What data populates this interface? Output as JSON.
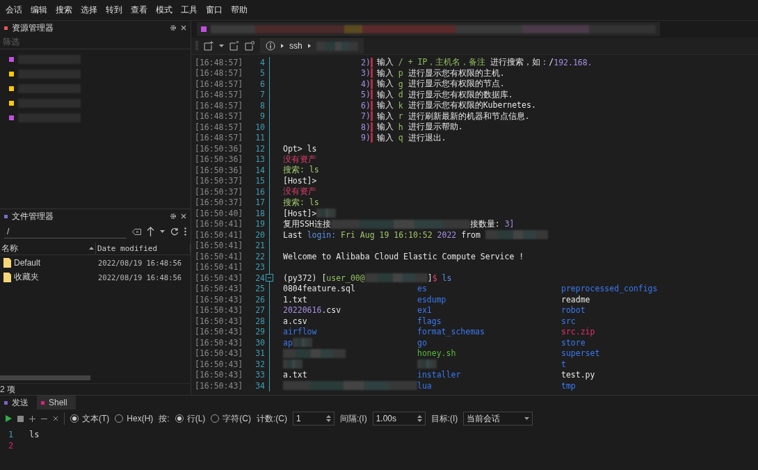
{
  "menu": [
    "会话",
    "编辑",
    "搜索",
    "选择",
    "转到",
    "查看",
    "模式",
    "工具",
    "窗口",
    "帮助"
  ],
  "resource_manager": {
    "title": "资源管理器",
    "filter": {
      "placeholder": "筛选"
    },
    "items": [
      {
        "color": "#c050e0"
      },
      {
        "color": "#ffcc00"
      },
      {
        "color": "#ffcc00"
      },
      {
        "color": "#ffcc00"
      },
      {
        "color": "#c050e0"
      }
    ]
  },
  "file_manager": {
    "title": "文件管理器",
    "path": "/",
    "columns": [
      "名称",
      "Date modified"
    ],
    "rows": [
      {
        "name": "Default",
        "date": "2022/08/19 16:48:56"
      },
      {
        "name": "收藏夹",
        "date": "2022/08/19 16:48:56"
      }
    ],
    "status": "2 项"
  },
  "toolbar": {
    "breadcrumb": [
      "ssh"
    ]
  },
  "terminal": {
    "lines": [
      {
        "time": "[16:48:57]",
        "num": "4",
        "segs": [
          {
            "kind": "marker",
            "text": "2)"
          },
          {
            "kind": "plain",
            "text": "输入 "
          },
          {
            "kind": "arg",
            "text": "/ + IP，主机名，备注"
          },
          {
            "kind": "plain",
            "text": " 进行搜索，如：/"
          },
          {
            "kind": "num",
            "text": "192.168."
          }
        ]
      },
      {
        "time": "[16:48:57]",
        "num": "5",
        "segs": [
          {
            "kind": "marker",
            "text": "3)"
          },
          {
            "kind": "plain",
            "text": "输入 "
          },
          {
            "kind": "arg",
            "text": "p"
          },
          {
            "kind": "plain",
            "text": " 进行显示您有权限的主机."
          }
        ]
      },
      {
        "time": "[16:48:57]",
        "num": "6",
        "segs": [
          {
            "kind": "marker",
            "text": "4)"
          },
          {
            "kind": "plain",
            "text": "输入 "
          },
          {
            "kind": "arg",
            "text": "g"
          },
          {
            "kind": "plain",
            "text": " 进行显示您有权限的节点."
          }
        ]
      },
      {
        "time": "[16:48:57]",
        "num": "7",
        "segs": [
          {
            "kind": "marker",
            "text": "5)"
          },
          {
            "kind": "plain",
            "text": "输入 "
          },
          {
            "kind": "arg",
            "text": "d"
          },
          {
            "kind": "plain",
            "text": " 进行显示您有权限的数据库."
          }
        ]
      },
      {
        "time": "[16:48:57]",
        "num": "8",
        "segs": [
          {
            "kind": "marker",
            "text": "6)"
          },
          {
            "kind": "plain",
            "text": "输入 "
          },
          {
            "kind": "arg",
            "text": "k"
          },
          {
            "kind": "plain",
            "text": " 进行显示您有权限的Kubernetes."
          }
        ]
      },
      {
        "time": "[16:48:57]",
        "num": "9",
        "segs": [
          {
            "kind": "marker",
            "text": "7)"
          },
          {
            "kind": "plain",
            "text": "输入 "
          },
          {
            "kind": "arg",
            "text": "r"
          },
          {
            "kind": "plain",
            "text": " 进行刷新最新的机器和节点信息."
          }
        ]
      },
      {
        "time": "[16:48:57]",
        "num": "10",
        "segs": [
          {
            "kind": "marker",
            "text": "8)"
          },
          {
            "kind": "plain",
            "text": "输入 "
          },
          {
            "kind": "arg",
            "text": "h"
          },
          {
            "kind": "plain",
            "text": " 进行显示帮助."
          }
        ]
      },
      {
        "time": "[16:48:57]",
        "num": "11",
        "segs": [
          {
            "kind": "marker",
            "text": "9)"
          },
          {
            "kind": "plain",
            "text": "输入 "
          },
          {
            "kind": "arg",
            "text": "q"
          },
          {
            "kind": "plain",
            "text": " 进行退出."
          }
        ]
      },
      {
        "time": "[16:50:36]",
        "num": "12",
        "segs": [
          {
            "kind": "plain",
            "text": "Opt> ls"
          }
        ]
      },
      {
        "time": "[16:50:36]",
        "num": "13",
        "segs": [
          {
            "kind": "error",
            "text": "没有资产"
          }
        ]
      },
      {
        "time": "[16:50:36]",
        "num": "14",
        "segs": [
          {
            "kind": "ok",
            "text": "搜索: ls"
          }
        ]
      },
      {
        "time": "[16:50:37]",
        "num": "15",
        "segs": [
          {
            "kind": "plain",
            "text": "[Host]>"
          }
        ]
      },
      {
        "time": "[16:50:37]",
        "num": "16",
        "segs": [
          {
            "kind": "error",
            "text": "没有资产"
          }
        ]
      },
      {
        "time": "[16:50:37]",
        "num": "17",
        "segs": [
          {
            "kind": "ok",
            "text": "搜索: ls"
          }
        ]
      },
      {
        "time": "[16:50:40]",
        "num": "18",
        "segs": [
          {
            "kind": "plain",
            "text": "[Host]>"
          },
          {
            "kind": "redact-s"
          }
        ]
      },
      {
        "time": "[16:50:41]",
        "num": "19",
        "segs": [
          {
            "kind": "plain",
            "text": "复用SSH连接"
          },
          {
            "kind": "redact-l"
          },
          {
            "kind": "plain",
            "text": "接数量: "
          },
          {
            "kind": "num",
            "text": "3]"
          }
        ]
      },
      {
        "time": "[16:50:41]",
        "num": "20",
        "segs": [
          {
            "kind": "plain",
            "text": "Last "
          },
          {
            "kind": "key",
            "text": "login:"
          },
          {
            "kind": "ok",
            "text": " Fri Aug 19 16:10:52 "
          },
          {
            "kind": "num",
            "text": "2022"
          },
          {
            "kind": "plain",
            "text": " from "
          },
          {
            "kind": "redact-m"
          }
        ]
      },
      {
        "time": "[16:50:41]",
        "num": "21"
      },
      {
        "time": "[16:50:41]",
        "num": "22",
        "segs": [
          {
            "kind": "plain",
            "text": "Welcome to Alibaba Cloud Elastic Compute Service !"
          }
        ]
      },
      {
        "time": "[16:50:41]",
        "num": "23"
      },
      {
        "time": "[16:50:43]",
        "num": "24",
        "fold": true,
        "segs": [
          {
            "kind": "plain",
            "text": "(py372) ["
          },
          {
            "kind": "arg",
            "text": "user_00@"
          },
          {
            "kind": "redact-m"
          },
          {
            "kind": "plain",
            "text": "]"
          },
          {
            "kind": "error",
            "text": "$"
          },
          {
            "kind": "key",
            "text": " ls"
          }
        ]
      },
      {
        "time": "[16:50:43]",
        "num": "25",
        "cols": [
          [
            {
              "kind": "plain",
              "text": "0804feature.sql"
            }
          ],
          [
            {
              "kind": "dir",
              "text": "es"
            }
          ],
          [
            {
              "kind": "dir",
              "text": "preprocessed_configs"
            }
          ]
        ]
      },
      {
        "time": "[16:50:43]",
        "num": "26",
        "cols": [
          [
            {
              "kind": "plain",
              "text": "1.txt"
            }
          ],
          [
            {
              "kind": "dir",
              "text": "esdump"
            }
          ],
          [
            {
              "kind": "plain",
              "text": "readme"
            }
          ]
        ]
      },
      {
        "time": "[16:50:43]",
        "num": "27",
        "cols": [
          [
            {
              "kind": "num",
              "text": "20220616"
            },
            {
              "kind": "plain",
              "text": ".csv"
            }
          ],
          [
            {
              "kind": "dir",
              "text": "ex1"
            }
          ],
          [
            {
              "kind": "dir",
              "text": "robot"
            }
          ]
        ]
      },
      {
        "time": "[16:50:43]",
        "num": "28",
        "cols": [
          [
            {
              "kind": "plain",
              "text": "a.csv"
            }
          ],
          [
            {
              "kind": "dir",
              "text": "flags"
            }
          ],
          [
            {
              "kind": "dir",
              "text": "src"
            }
          ]
        ]
      },
      {
        "time": "[16:50:43]",
        "num": "29",
        "cols": [
          [
            {
              "kind": "dir",
              "text": "airflow"
            }
          ],
          [
            {
              "kind": "dir",
              "text": "format_schemas"
            }
          ],
          [
            {
              "kind": "archive",
              "text": "src.zip"
            }
          ]
        ]
      },
      {
        "time": "[16:50:43]",
        "num": "30",
        "cols": [
          [
            {
              "kind": "dir",
              "text": "ap"
            },
            {
              "kind": "redact-s"
            }
          ],
          [
            {
              "kind": "dir",
              "text": "go"
            }
          ],
          [
            {
              "kind": "dir",
              "text": "store"
            }
          ]
        ]
      },
      {
        "time": "[16:50:43]",
        "num": "31",
        "cols": [
          [
            {
              "kind": "redact-m"
            }
          ],
          [
            {
              "kind": "exec",
              "text": "honey.sh"
            }
          ],
          [
            {
              "kind": "dir",
              "text": "superset"
            }
          ]
        ]
      },
      {
        "time": "[16:50:43]",
        "num": "32",
        "cols": [
          [
            {
              "kind": "redact-s"
            }
          ],
          [
            {
              "kind": "redact-s"
            }
          ],
          [
            {
              "kind": "dir",
              "text": "t"
            }
          ]
        ]
      },
      {
        "time": "[16:50:43]",
        "num": "33",
        "cols": [
          [
            {
              "kind": "plain",
              "text": "a.txt"
            }
          ],
          [
            {
              "kind": "dir",
              "text": "installer"
            }
          ],
          [
            {
              "kind": "plain",
              "text": "test.py"
            }
          ]
        ]
      },
      {
        "time": "[16:50:43]",
        "num": "34",
        "cols": [
          [
            {
              "kind": "redact-l"
            }
          ],
          [
            {
              "kind": "dir",
              "text": "lua"
            }
          ],
          [
            {
              "kind": "dir",
              "text": "tmp"
            }
          ]
        ]
      }
    ]
  },
  "send_panel": {
    "tabs": [
      {
        "label": "发送",
        "color": "#8060d0",
        "selected": false
      },
      {
        "label": "Shell",
        "color": "#e0207a",
        "selected": true
      }
    ],
    "format": [
      {
        "label": "文本(T)",
        "selected": true
      },
      {
        "label": "Hex(H)",
        "selected": false
      }
    ],
    "by_label": "按:",
    "mode": [
      {
        "label": "行(L)",
        "selected": true
      },
      {
        "label": "字符(C)",
        "selected": false
      }
    ],
    "count": {
      "label": "计数:(C)",
      "value": "1"
    },
    "interval": {
      "label": "间隔:(I)",
      "value": "1.00s"
    },
    "target": {
      "label": "目标:(I)",
      "value": "当前会话"
    },
    "editor": [
      {
        "num": "1",
        "text": "ls",
        "selected": false
      },
      {
        "num": "2",
        "selected": true
      }
    ]
  }
}
